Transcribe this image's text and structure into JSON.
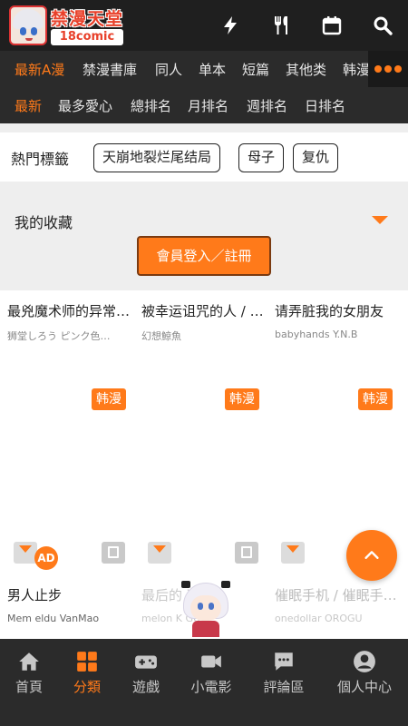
{
  "header": {
    "logo_title": "禁漫天堂",
    "logo_sub": "18comic",
    "icons": [
      "lightning-icon",
      "fork-knife-icon",
      "calendar-icon",
      "search-icon"
    ]
  },
  "categories": {
    "items": [
      "最新A漫",
      "禁漫書庫",
      "同人",
      "单本",
      "短篇",
      "其他类",
      "韩漫"
    ],
    "active_index": 0
  },
  "sorts": {
    "items": [
      "最新",
      "最多愛心",
      "總排名",
      "月排名",
      "週排名",
      "日排名"
    ],
    "active_index": 0
  },
  "hot_tags": {
    "label": "熱門標籤",
    "tags": [
      "天崩地裂烂尾结局",
      "母子",
      "复仇"
    ]
  },
  "favorites": {
    "label": "我的收藏",
    "login_button": "會員登入／註冊"
  },
  "grid_row1": [
    {
      "title": "最兇魔术师的异常…",
      "author": "狮堂しろう ピンク色…",
      "badge": "韩漫"
    },
    {
      "title": "被幸运诅咒的人 / …",
      "author": "幻想鯨魚",
      "badge": "韩漫"
    },
    {
      "title": "请弄脏我的女朋友",
      "author": "babyhands Y.N.B",
      "badge": "韩漫"
    }
  ],
  "grid_row2": [
    {
      "title": "男人止步",
      "author": "Mem eldu VanMao",
      "ad": "AD"
    },
    {
      "title": "最后的 冲刺…",
      "author": "melon K GUY"
    },
    {
      "title": "催眠手机 / 催眠手…",
      "author": "onedollar OROGU"
    }
  ],
  "bottom_nav": {
    "items": [
      "首頁",
      "分類",
      "遊戲",
      "小電影",
      "評論區",
      "個人中心"
    ],
    "active_index": 1
  },
  "colors": {
    "accent": "#ff7a1a",
    "dark_bar": "#2b2b2b",
    "header": "#1f1f1f"
  }
}
